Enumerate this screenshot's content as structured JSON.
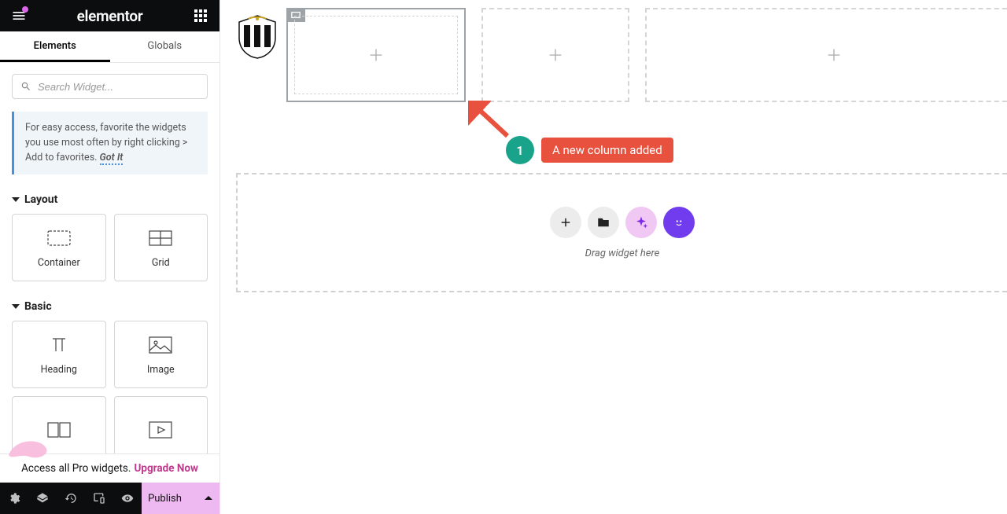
{
  "header": {
    "logo": "elementor"
  },
  "tabs": {
    "elements": "Elements",
    "globals": "Globals"
  },
  "search": {
    "placeholder": "Search Widget..."
  },
  "tip": {
    "text": "For easy access, favorite the widgets you use most often by right clicking > Add to favorites.",
    "gotit": "Got It"
  },
  "sections": {
    "layout": "Layout",
    "basic": "Basic"
  },
  "widgets": {
    "container": "Container",
    "grid": "Grid",
    "heading": "Heading",
    "image": "Image"
  },
  "upsell": {
    "text": "Access all Pro widgets.",
    "cta": "Upgrade Now"
  },
  "footer": {
    "publish": "Publish"
  },
  "annotation": {
    "badge": "1",
    "label": "A new column added"
  },
  "drop": {
    "text": "Drag widget here"
  }
}
